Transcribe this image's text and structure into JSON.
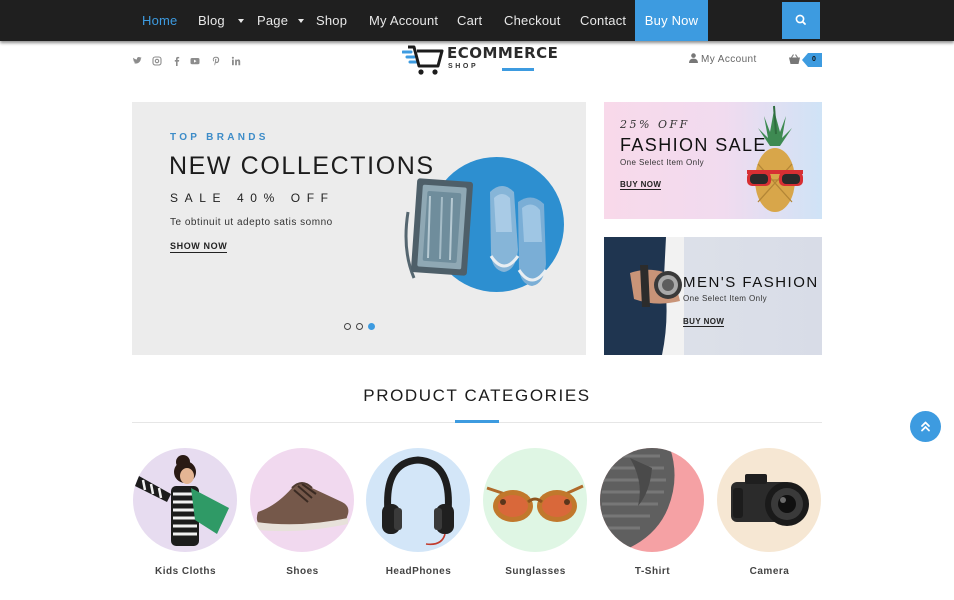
{
  "nav": {
    "items": [
      "Home",
      "Blog",
      "Page",
      "Shop",
      "My Account",
      "Cart",
      "Checkout",
      "Contact"
    ],
    "buy_now": "Buy Now",
    "active": "Home"
  },
  "header": {
    "social_icons": [
      "twitter-icon",
      "instagram-icon",
      "facebook-icon",
      "youtube-icon",
      "pinterest-icon",
      "linkedin-icon"
    ],
    "logo_title": "ECOMMERCE",
    "logo_sub": "SHOP",
    "account_label": "My Account",
    "cart_count": "0"
  },
  "hero": {
    "kicker": "TOP BRANDS",
    "title": "NEW COLLECTIONS",
    "sale": "SALE 40% OFF",
    "desc": "Te obtinuit ut adepto satis somno",
    "cta": "SHOW NOW",
    "slides": 3,
    "active_slide": 3
  },
  "banners": [
    {
      "tag": "25% OFF",
      "title": "FASHION SALE",
      "sub": "One Select Item Only",
      "cta": "BUY NOW"
    },
    {
      "title": "MEN'S FASHION",
      "sub": "One Select Item Only",
      "cta": "BUY NOW"
    }
  ],
  "categories": {
    "title": "PRODUCT CATEGORIES",
    "items": [
      "Kids Cloths",
      "Shoes",
      "HeadPhones",
      "Sunglasses",
      "T-Shirt",
      "Camera"
    ]
  },
  "colors": {
    "accent": "#3d9be0",
    "nav_bg": "#1f1f1f"
  }
}
